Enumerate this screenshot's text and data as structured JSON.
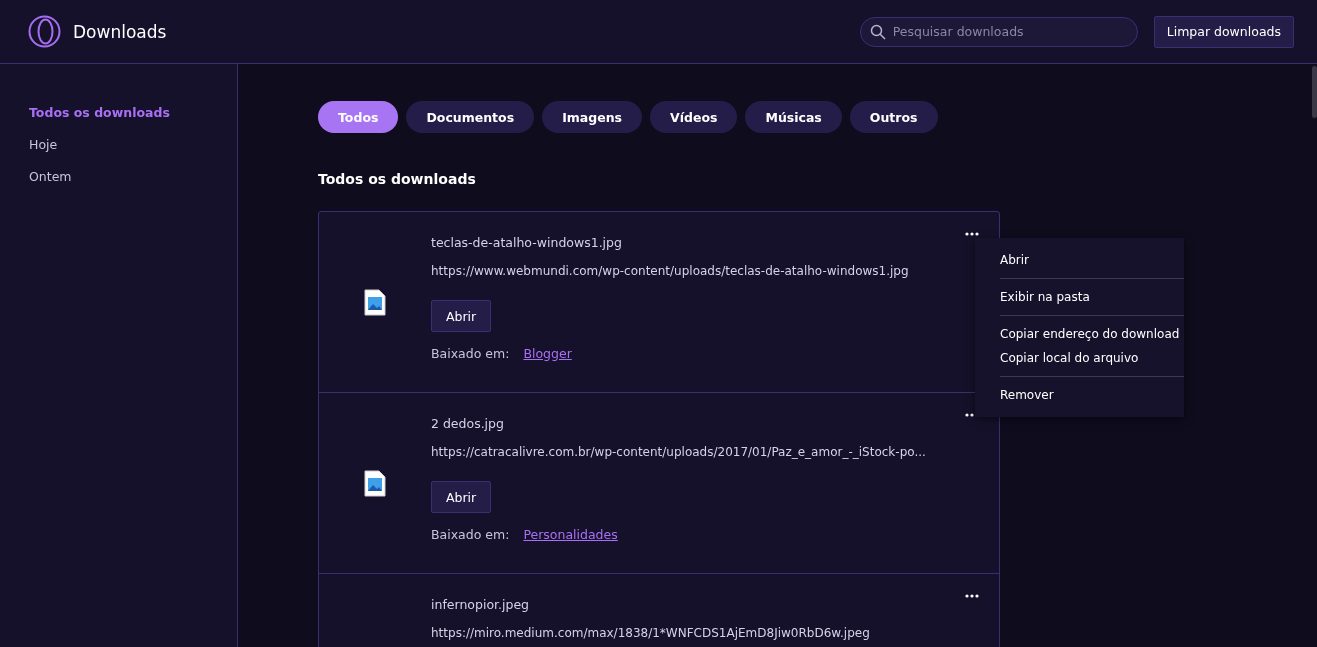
{
  "header": {
    "title": "Downloads",
    "search": {
      "placeholder": "Pesquisar downloads"
    },
    "clear_button": "Limpar downloads"
  },
  "sidebar": {
    "items": [
      {
        "label": "Todos os downloads",
        "selected": true
      },
      {
        "label": "Hoje",
        "selected": false
      },
      {
        "label": "Ontem",
        "selected": false
      }
    ]
  },
  "tabs": [
    {
      "label": "Todos",
      "selected": true
    },
    {
      "label": "Documentos",
      "selected": false
    },
    {
      "label": "Imagens",
      "selected": false
    },
    {
      "label": "Vídeos",
      "selected": false
    },
    {
      "label": "Músicas",
      "selected": false
    },
    {
      "label": "Outros",
      "selected": false
    }
  ],
  "section_title": "Todos os downloads",
  "downloads": [
    {
      "name": "teclas-de-atalho-windows1.jpg",
      "url": "https://www.webmundi.com/wp-content/uploads/teclas-de-atalho-windows1.jpg",
      "open_button": "Abrir",
      "source_label": "Baixado em:",
      "source": "Blogger"
    },
    {
      "name": "2 dedos.jpg",
      "url": "https://catracalivre.com.br/wp-content/uploads/2017/01/Paz_e_amor_-_iStock-po...",
      "open_button": "Abrir",
      "source_label": "Baixado em:",
      "source": "Personalidades"
    },
    {
      "name": "infernopior.jpeg",
      "url": "https://miro.medium.com/max/1838/1*WNFCDS1AjEmD8Jiw0RbD6w.jpeg"
    }
  ],
  "context_menu": {
    "groups": [
      [
        "Abrir"
      ],
      [
        "Exibir na pasta"
      ],
      [
        "Copiar endereço do download",
        "Copiar local do arquivo"
      ],
      [
        "Remover"
      ]
    ]
  }
}
